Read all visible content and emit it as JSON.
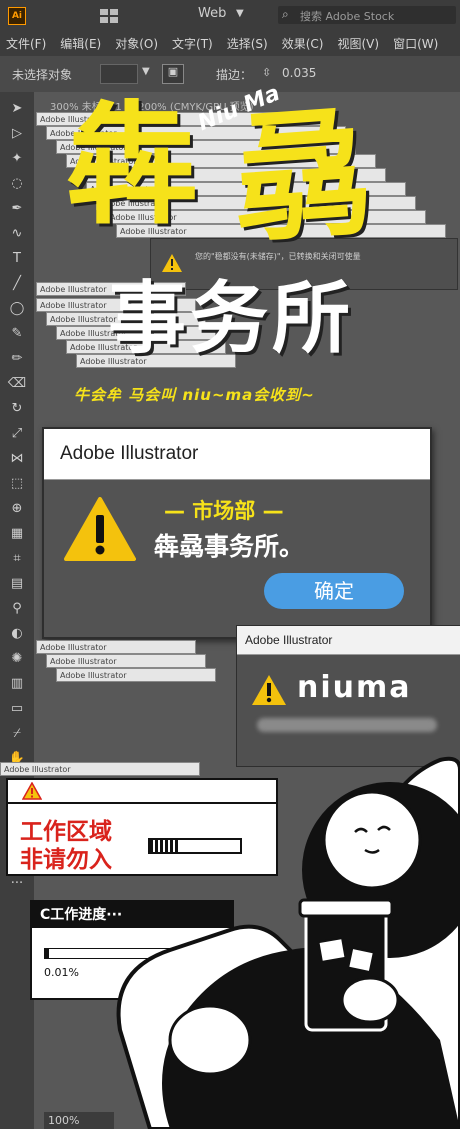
{
  "app": {
    "logo": "Ai",
    "workspace": "Web",
    "search_placeholder": "搜索 Adobe Stock"
  },
  "menu": [
    "文件(F)",
    "编辑(E)",
    "对象(O)",
    "文字(T)",
    "选择(S)",
    "效果(C)",
    "视图(V)",
    "窗口(W)"
  ],
  "control_bar": {
    "selection": "未选择对象",
    "stroke_label": "描边：",
    "stroke_value": "0.035"
  },
  "doc_tab": "300%  未标题-1 @ 200% (CMYK/GPU 预览)",
  "stacked_title": "Adobe Illustrator",
  "poster": {
    "title_line1": "犇",
    "title_line1b": "骉",
    "title_line2": "事务所",
    "niu_ma": "Niu Ma",
    "tagline": "牛会牟  马会叫 niu~ma会收到~",
    "warning_bg_text": "您的\"稳都没有(未储存)\"，已转换和关闭可使量"
  },
  "main_dialog": {
    "title": "Adobe Illustrator",
    "dept": "— 市场部 —",
    "message": "犇骉事务所。",
    "ok": "确定"
  },
  "second_dialog": {
    "title": "Adobe Illustrator",
    "message": "niuma"
  },
  "zone_box": {
    "line1": "工作区域",
    "line2": "非请勿入"
  },
  "progress_box": {
    "title": "C工作进度···",
    "value_label": "0.01%",
    "value": 0.01
  },
  "status": {
    "zoom": "100%"
  },
  "colors": {
    "yellow": "#f6e21a",
    "warning_yellow": "#f4c20d",
    "red": "#d9231c",
    "blue": "#4a9de3"
  }
}
